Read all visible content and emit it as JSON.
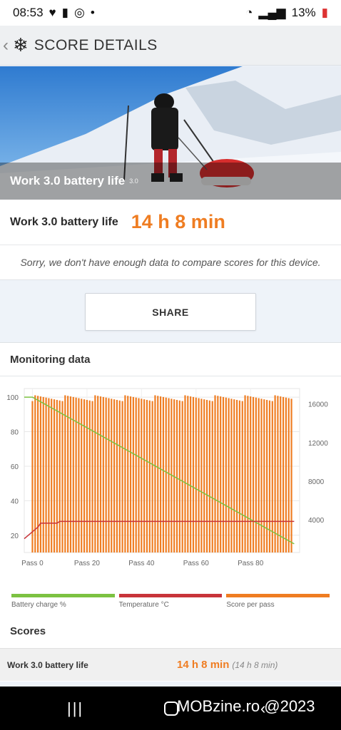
{
  "status": {
    "time": "08:53",
    "battery": "13%"
  },
  "header": {
    "title": "SCORE DETAILS"
  },
  "hero": {
    "caption": "Work 3.0 battery life",
    "version": "3.0"
  },
  "score": {
    "label": "Work 3.0 battery life",
    "value": "14 h 8 min"
  },
  "notice": "Sorry, we don't have enough data to compare scores for this device.",
  "share_label": "SHARE",
  "monitoring": {
    "title": "Monitoring data",
    "legend": [
      {
        "label": "Battery charge %",
        "color": "#7cc242"
      },
      {
        "label": "Temperature °C",
        "color": "#c8343a"
      },
      {
        "label": "Score per pass",
        "color": "#ef7d22"
      }
    ]
  },
  "scores": {
    "title": "Scores",
    "row_label": "Work 3.0 battery life",
    "row_value": "14 h 8 min",
    "row_sub": "(14 h 8 min)"
  },
  "watermark": "MOBzine.ro @2023",
  "chart_data": {
    "type": "bar",
    "x_ticks": [
      "Pass 0",
      "Pass 20",
      "Pass 40",
      "Pass 60",
      "Pass 80"
    ],
    "y_left_ticks": [
      "20",
      "40",
      "60",
      "80",
      "100"
    ],
    "y_right_ticks": [
      "4000",
      "8000",
      "12000",
      "16000"
    ],
    "ylim_left": [
      10,
      105
    ],
    "ylim_right": [
      600,
      17600
    ],
    "xlim": [
      -3,
      98
    ],
    "passes": 96,
    "series": [
      {
        "name": "Score per pass",
        "axis": "right",
        "approx_value": 16600
      },
      {
        "name": "Battery charge %",
        "axis": "left",
        "start": 100,
        "end": 15
      },
      {
        "name": "Temperature °C",
        "axis": "left",
        "start": 18,
        "plateau": 28
      }
    ],
    "grid": true
  }
}
